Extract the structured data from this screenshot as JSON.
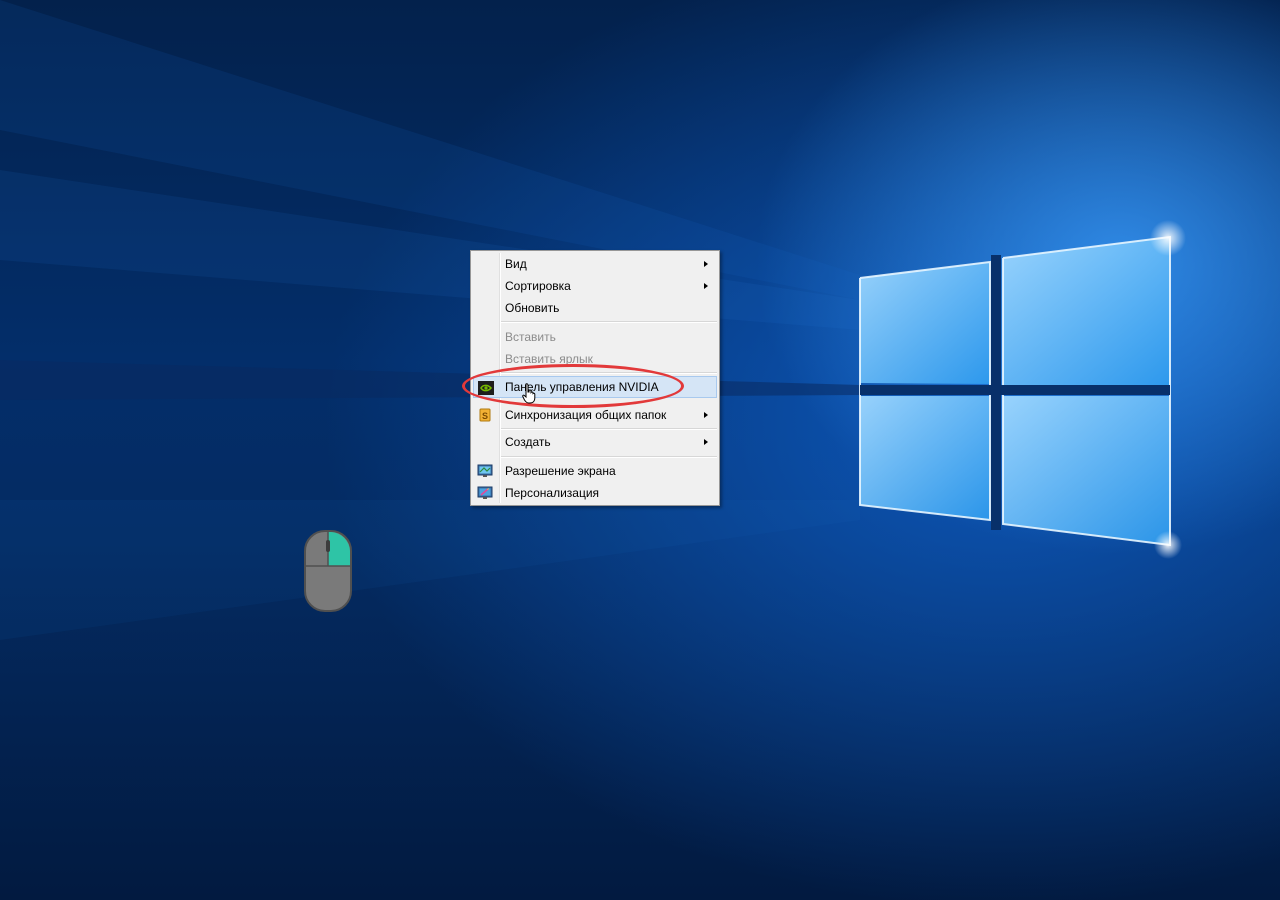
{
  "context_menu": {
    "items": [
      {
        "label": "Вид",
        "submenu": true,
        "disabled": false
      },
      {
        "label": "Сортировка",
        "submenu": true,
        "disabled": false
      },
      {
        "label": "Обновить",
        "submenu": false,
        "disabled": false
      },
      {
        "label": "Вставить",
        "submenu": false,
        "disabled": true
      },
      {
        "label": "Вставить ярлык",
        "submenu": false,
        "disabled": true
      },
      {
        "label": "Панель управления NVIDIA",
        "submenu": false,
        "disabled": false,
        "icon": "nvidia-icon",
        "highlighted": true
      },
      {
        "label": "Синхронизация общих папок",
        "submenu": true,
        "disabled": false,
        "icon": "sync-folders-icon"
      },
      {
        "label": "Создать",
        "submenu": true,
        "disabled": false
      },
      {
        "label": "Разрешение экрана",
        "submenu": false,
        "disabled": false,
        "icon": "display-resolution-icon"
      },
      {
        "label": "Персонализация",
        "submenu": false,
        "disabled": false,
        "icon": "personalization-icon"
      }
    ]
  },
  "annotation": {
    "color": "#e2393a",
    "target": "Панель управления NVIDIA"
  },
  "mouse_hint": {
    "button": "right",
    "accent": "#2ec4a6"
  },
  "colors": {
    "menu_background": "#f0f0f0",
    "highlight_background": "#d5e5f6",
    "highlight_border": "#a8c9ee",
    "disabled_text": "#8b8b8b",
    "wallpaper_base": "#032e6a"
  }
}
